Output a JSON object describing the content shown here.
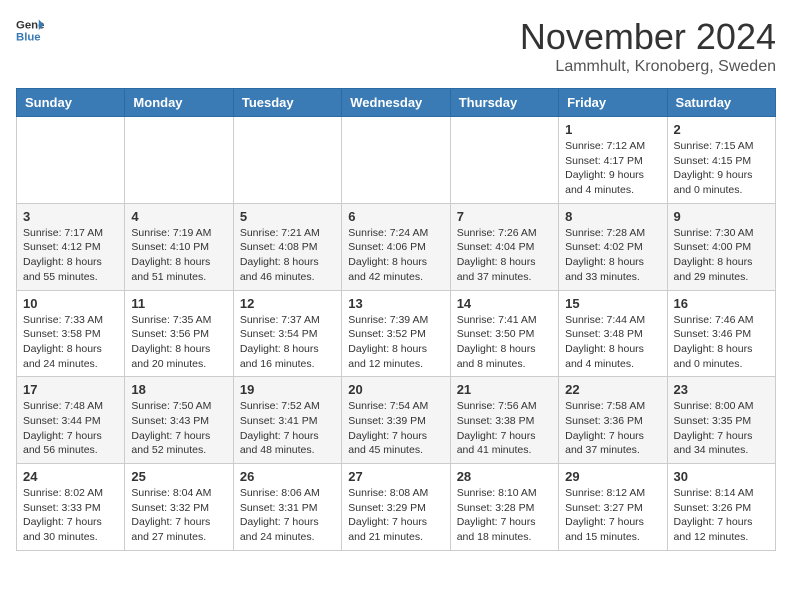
{
  "header": {
    "logo_general": "General",
    "logo_blue": "Blue",
    "month_title": "November 2024",
    "location": "Lammhult, Kronoberg, Sweden"
  },
  "weekdays": [
    "Sunday",
    "Monday",
    "Tuesday",
    "Wednesday",
    "Thursday",
    "Friday",
    "Saturday"
  ],
  "weeks": [
    [
      {
        "day": "",
        "info": ""
      },
      {
        "day": "",
        "info": ""
      },
      {
        "day": "",
        "info": ""
      },
      {
        "day": "",
        "info": ""
      },
      {
        "day": "",
        "info": ""
      },
      {
        "day": "1",
        "info": "Sunrise: 7:12 AM\nSunset: 4:17 PM\nDaylight: 9 hours\nand 4 minutes."
      },
      {
        "day": "2",
        "info": "Sunrise: 7:15 AM\nSunset: 4:15 PM\nDaylight: 9 hours\nand 0 minutes."
      }
    ],
    [
      {
        "day": "3",
        "info": "Sunrise: 7:17 AM\nSunset: 4:12 PM\nDaylight: 8 hours\nand 55 minutes."
      },
      {
        "day": "4",
        "info": "Sunrise: 7:19 AM\nSunset: 4:10 PM\nDaylight: 8 hours\nand 51 minutes."
      },
      {
        "day": "5",
        "info": "Sunrise: 7:21 AM\nSunset: 4:08 PM\nDaylight: 8 hours\nand 46 minutes."
      },
      {
        "day": "6",
        "info": "Sunrise: 7:24 AM\nSunset: 4:06 PM\nDaylight: 8 hours\nand 42 minutes."
      },
      {
        "day": "7",
        "info": "Sunrise: 7:26 AM\nSunset: 4:04 PM\nDaylight: 8 hours\nand 37 minutes."
      },
      {
        "day": "8",
        "info": "Sunrise: 7:28 AM\nSunset: 4:02 PM\nDaylight: 8 hours\nand 33 minutes."
      },
      {
        "day": "9",
        "info": "Sunrise: 7:30 AM\nSunset: 4:00 PM\nDaylight: 8 hours\nand 29 minutes."
      }
    ],
    [
      {
        "day": "10",
        "info": "Sunrise: 7:33 AM\nSunset: 3:58 PM\nDaylight: 8 hours\nand 24 minutes."
      },
      {
        "day": "11",
        "info": "Sunrise: 7:35 AM\nSunset: 3:56 PM\nDaylight: 8 hours\nand 20 minutes."
      },
      {
        "day": "12",
        "info": "Sunrise: 7:37 AM\nSunset: 3:54 PM\nDaylight: 8 hours\nand 16 minutes."
      },
      {
        "day": "13",
        "info": "Sunrise: 7:39 AM\nSunset: 3:52 PM\nDaylight: 8 hours\nand 12 minutes."
      },
      {
        "day": "14",
        "info": "Sunrise: 7:41 AM\nSunset: 3:50 PM\nDaylight: 8 hours\nand 8 minutes."
      },
      {
        "day": "15",
        "info": "Sunrise: 7:44 AM\nSunset: 3:48 PM\nDaylight: 8 hours\nand 4 minutes."
      },
      {
        "day": "16",
        "info": "Sunrise: 7:46 AM\nSunset: 3:46 PM\nDaylight: 8 hours\nand 0 minutes."
      }
    ],
    [
      {
        "day": "17",
        "info": "Sunrise: 7:48 AM\nSunset: 3:44 PM\nDaylight: 7 hours\nand 56 minutes."
      },
      {
        "day": "18",
        "info": "Sunrise: 7:50 AM\nSunset: 3:43 PM\nDaylight: 7 hours\nand 52 minutes."
      },
      {
        "day": "19",
        "info": "Sunrise: 7:52 AM\nSunset: 3:41 PM\nDaylight: 7 hours\nand 48 minutes."
      },
      {
        "day": "20",
        "info": "Sunrise: 7:54 AM\nSunset: 3:39 PM\nDaylight: 7 hours\nand 45 minutes."
      },
      {
        "day": "21",
        "info": "Sunrise: 7:56 AM\nSunset: 3:38 PM\nDaylight: 7 hours\nand 41 minutes."
      },
      {
        "day": "22",
        "info": "Sunrise: 7:58 AM\nSunset: 3:36 PM\nDaylight: 7 hours\nand 37 minutes."
      },
      {
        "day": "23",
        "info": "Sunrise: 8:00 AM\nSunset: 3:35 PM\nDaylight: 7 hours\nand 34 minutes."
      }
    ],
    [
      {
        "day": "24",
        "info": "Sunrise: 8:02 AM\nSunset: 3:33 PM\nDaylight: 7 hours\nand 30 minutes."
      },
      {
        "day": "25",
        "info": "Sunrise: 8:04 AM\nSunset: 3:32 PM\nDaylight: 7 hours\nand 27 minutes."
      },
      {
        "day": "26",
        "info": "Sunrise: 8:06 AM\nSunset: 3:31 PM\nDaylight: 7 hours\nand 24 minutes."
      },
      {
        "day": "27",
        "info": "Sunrise: 8:08 AM\nSunset: 3:29 PM\nDaylight: 7 hours\nand 21 minutes."
      },
      {
        "day": "28",
        "info": "Sunrise: 8:10 AM\nSunset: 3:28 PM\nDaylight: 7 hours\nand 18 minutes."
      },
      {
        "day": "29",
        "info": "Sunrise: 8:12 AM\nSunset: 3:27 PM\nDaylight: 7 hours\nand 15 minutes."
      },
      {
        "day": "30",
        "info": "Sunrise: 8:14 AM\nSunset: 3:26 PM\nDaylight: 7 hours\nand 12 minutes."
      }
    ]
  ]
}
